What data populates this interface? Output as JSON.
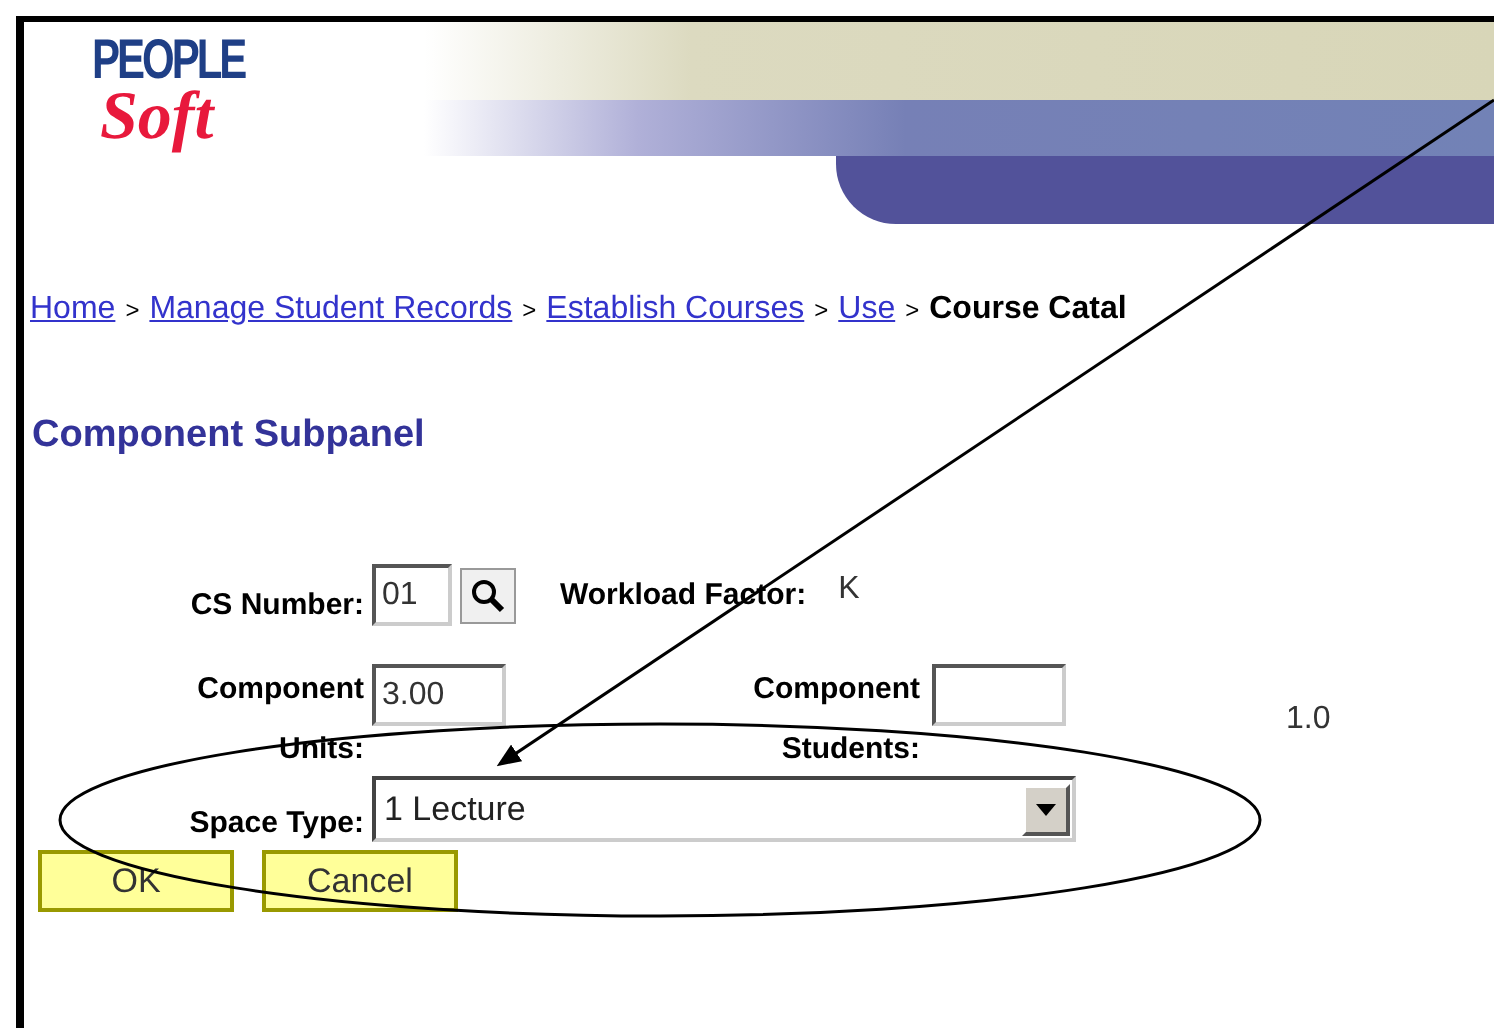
{
  "logo": {
    "top": "PEOPLE",
    "bottom": "Soft"
  },
  "breadcrumb": {
    "links": [
      "Home",
      "Manage Student Records",
      "Establish Courses",
      "Use"
    ],
    "separator": ">",
    "current": "Course Catal"
  },
  "page_title": "Component Subpanel",
  "form": {
    "cs_number": {
      "label": "CS Number:",
      "value": "01"
    },
    "workload_factor": {
      "label": "Workload Factor:",
      "value": "K"
    },
    "component_units": {
      "label_1": "Component",
      "label_2": "Units:",
      "value": "3.00"
    },
    "component_students": {
      "label_1": "Component",
      "label_2": "Students:"
    },
    "ratio": "1.0",
    "space_type": {
      "label": "Space Type:",
      "value": "1 Lecture"
    }
  },
  "buttons": [
    "OK",
    "Cancel"
  ]
}
